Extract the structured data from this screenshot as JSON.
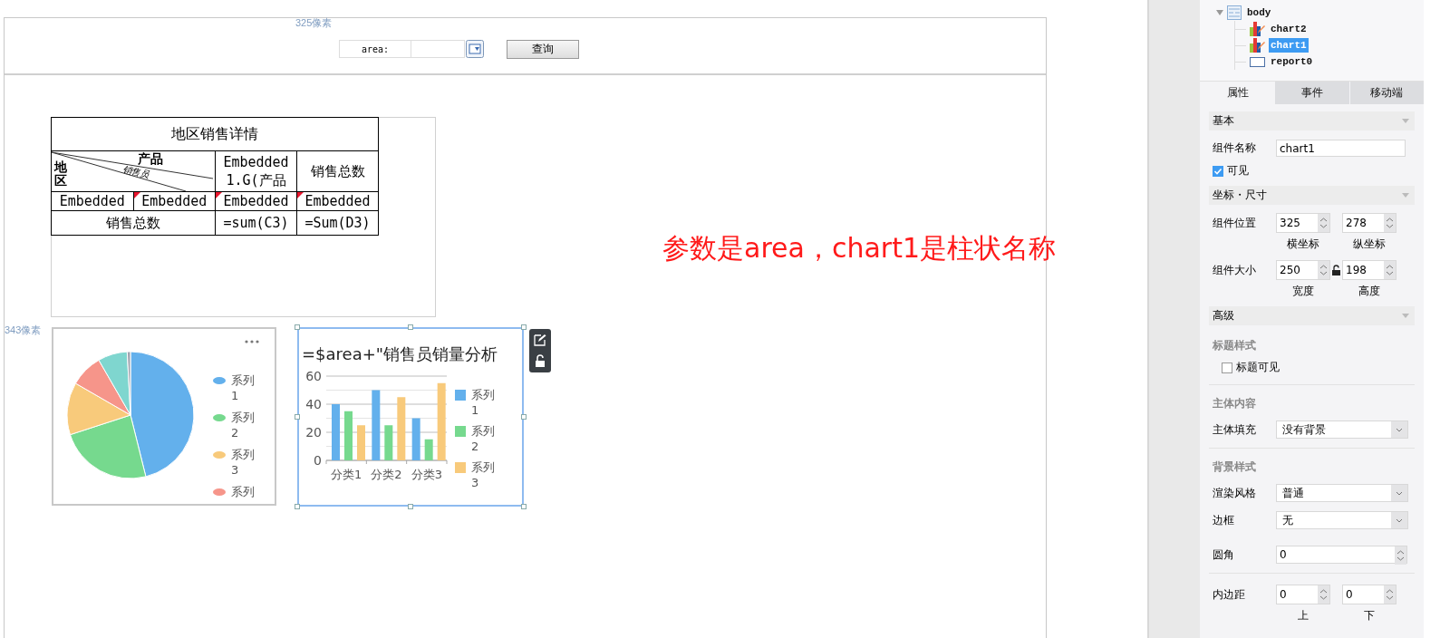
{
  "param_panel": {
    "width_hint": "325像素",
    "label": "area:",
    "query_button": "查询"
  },
  "height_hint": "343像素",
  "report_table": {
    "title": "地区销售详情",
    "corner": {
      "top": "产品",
      "diagonal": "销售员",
      "left": "地区"
    },
    "header": [
      {
        "text": "Embedded1.G(产品",
        "flagged": false
      },
      {
        "text": "销售总数",
        "flagged": false
      }
    ],
    "data_row": [
      {
        "text": "Embedded",
        "flagged": false
      },
      {
        "text": "Embedded",
        "flagged": true
      },
      {
        "text": "Embedded",
        "flagged": true
      },
      {
        "text": "Embedded",
        "flagged": true
      }
    ],
    "total_row": [
      "销售总数",
      "=sum(C3)",
      "=Sum(D3)"
    ]
  },
  "pie_chart": {
    "legend": [
      {
        "label": "系列1",
        "color": "#63b0ec"
      },
      {
        "label": "系列2",
        "color": "#76d98e"
      },
      {
        "label": "系列3",
        "color": "#f8ca7b"
      },
      {
        "label": "系列",
        "color": "#f6958a"
      }
    ]
  },
  "bar_chart": {
    "selected": true,
    "chart_data": {
      "type": "bar",
      "grid": true,
      "title": "=$area+\"销售员销量分析",
      "categories": [
        "分类1",
        "分类2",
        "分类3"
      ],
      "ylim": [
        0,
        60
      ],
      "yticks": [
        0,
        20,
        40,
        60
      ],
      "series": [
        {
          "name": "系列1",
          "color": "#63b0ec",
          "values": [
            40,
            50,
            30
          ]
        },
        {
          "name": "系列2",
          "color": "#76d98e",
          "values": [
            35,
            25,
            15
          ]
        },
        {
          "name": "系列3",
          "color": "#f8ca7b",
          "values": [
            25,
            45,
            55
          ]
        }
      ]
    }
  },
  "annotation": "参数是area，chart1是柱状名称",
  "tree": {
    "label": "body",
    "expanded": true,
    "children": [
      {
        "label": "chart2",
        "kind": "chart",
        "selected": false
      },
      {
        "label": "chart1",
        "kind": "chart",
        "selected": true
      },
      {
        "label": "report0",
        "kind": "report",
        "selected": false
      }
    ]
  },
  "tabs": [
    {
      "label": "属性",
      "selected": true
    },
    {
      "label": "事件",
      "selected": false
    },
    {
      "label": "移动端",
      "selected": false
    }
  ],
  "properties": [
    {
      "kind": "header",
      "label": "基本"
    },
    {
      "kind": "text",
      "label": "组件名称",
      "value": "chart1"
    },
    {
      "kind": "check",
      "label": "可见",
      "checked": true
    },
    {
      "kind": "header",
      "label": "坐标・尺寸"
    },
    {
      "kind": "pair",
      "label": "组件位置",
      "fields": [
        {
          "value": "325",
          "caption": "横坐标"
        },
        {
          "value": "278",
          "caption": "纵坐标"
        }
      ]
    },
    {
      "kind": "pair",
      "label": "组件大小",
      "locked": false,
      "fields": [
        {
          "value": "250",
          "caption": "宽度"
        },
        {
          "value": "198",
          "caption": "高度"
        }
      ]
    },
    {
      "kind": "header",
      "label": "高级"
    },
    {
      "kind": "subhead",
      "label": "标题样式"
    },
    {
      "kind": "check",
      "label": "标题可见",
      "checked": false
    },
    {
      "kind": "subhead",
      "label": "主体内容"
    },
    {
      "kind": "select",
      "label": "主体填充",
      "value": "没有背景"
    },
    {
      "kind": "subhead",
      "label": "背景样式"
    },
    {
      "kind": "select",
      "label": "渲染风格",
      "value": "普通"
    },
    {
      "kind": "select",
      "label": "边框",
      "value": "无"
    },
    {
      "kind": "spin",
      "label": "圆角",
      "value": "0"
    },
    {
      "kind": "pair",
      "label": "内边距",
      "fields": [
        {
          "value": "0",
          "caption": "上"
        },
        {
          "value": "0",
          "caption": "下"
        }
      ]
    }
  ]
}
